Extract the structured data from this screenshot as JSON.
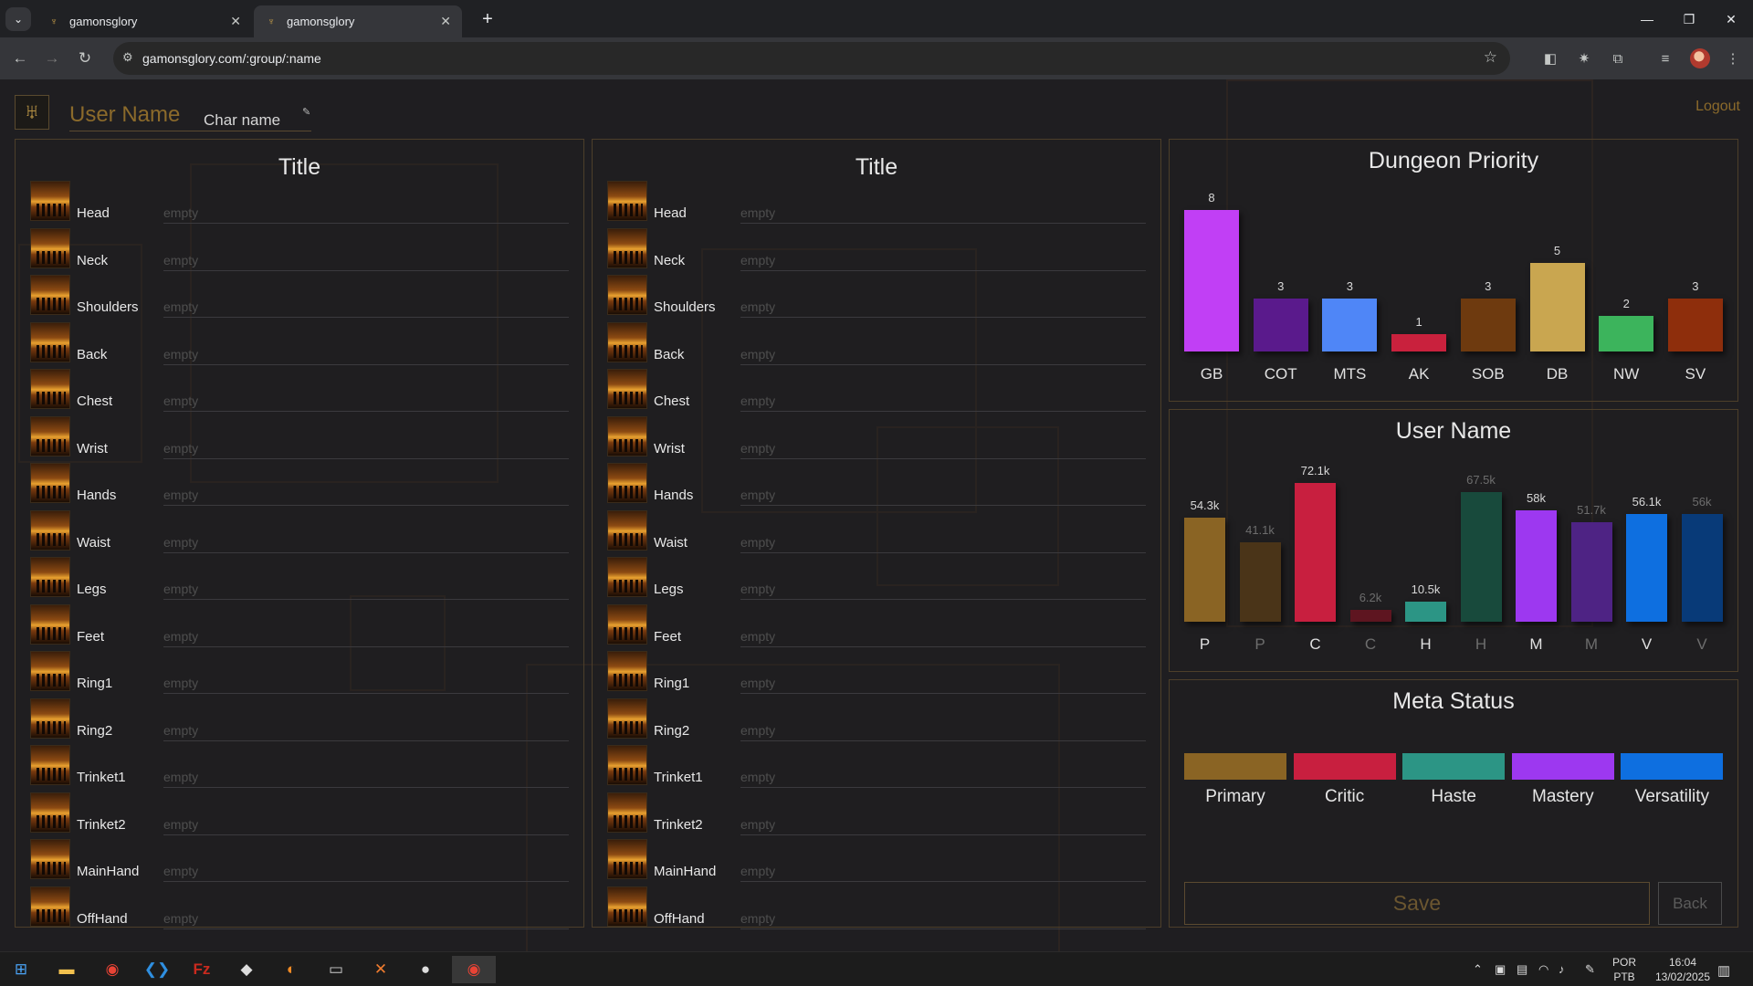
{
  "browser": {
    "tabs": [
      {
        "title": "gamonsglory",
        "active": false
      },
      {
        "title": "gamonsglory",
        "active": true
      }
    ],
    "url": "gamonsglory.com/:group/:name"
  },
  "header": {
    "user_name": "User Name",
    "char_name": "Char name",
    "logout_label": "Logout"
  },
  "gear_panels": [
    {
      "title": "Title"
    },
    {
      "title": "Title"
    }
  ],
  "slots": [
    {
      "label": "Head",
      "value": "empty"
    },
    {
      "label": "Neck",
      "value": "empty"
    },
    {
      "label": "Shoulders",
      "value": "empty"
    },
    {
      "label": "Back",
      "value": "empty"
    },
    {
      "label": "Chest",
      "value": "empty"
    },
    {
      "label": "Wrist",
      "value": "empty"
    },
    {
      "label": "Hands",
      "value": "empty"
    },
    {
      "label": "Waist",
      "value": "empty"
    },
    {
      "label": "Legs",
      "value": "empty"
    },
    {
      "label": "Feet",
      "value": "empty"
    },
    {
      "label": "Ring1",
      "value": "empty"
    },
    {
      "label": "Ring2",
      "value": "empty"
    },
    {
      "label": "Trinket1",
      "value": "empty"
    },
    {
      "label": "Trinket2",
      "value": "empty"
    },
    {
      "label": "MainHand",
      "value": "empty"
    },
    {
      "label": "OffHand",
      "value": "empty"
    }
  ],
  "chart_data": [
    {
      "type": "bar",
      "title": "Dungeon Priority",
      "categories": [
        "GB",
        "COT",
        "MTS",
        "AK",
        "SOB",
        "DB",
        "NW",
        "SV"
      ],
      "values": [
        8,
        3,
        3,
        1,
        3,
        5,
        2,
        3
      ],
      "value_labels": [
        "8",
        "3",
        "3",
        "1",
        "3",
        "5",
        "2",
        "3"
      ],
      "colors": [
        "#c13ff5",
        "#5a1a8c",
        "#4f86f7",
        "#c9213d",
        "#6e3a0f",
        "#c9a650",
        "#3cb45c",
        "#8e2e0c"
      ],
      "ylim": [
        0,
        8
      ]
    },
    {
      "type": "bar",
      "title": "User Name",
      "categories": [
        "P",
        "P",
        "C",
        "C",
        "H",
        "H",
        "M",
        "M",
        "V",
        "V"
      ],
      "values": [
        54.3,
        41.1,
        72.1,
        6.2,
        10.5,
        67.5,
        58,
        51.7,
        56.1,
        56
      ],
      "value_labels": [
        "54.3k",
        "41.1k",
        "72.1k",
        "6.2k",
        "10.5k",
        "67.5k",
        "58k",
        "51.7k",
        "56.1k",
        "56k"
      ],
      "dimmed": [
        false,
        true,
        false,
        true,
        false,
        true,
        false,
        true,
        false,
        true
      ],
      "colors": [
        "#8a6424",
        "#4a3418",
        "#c81f3f",
        "#5e1520",
        "#2c9585",
        "#184a3c",
        "#9d38f0",
        "#4e2384",
        "#0e6fe0",
        "#083a78"
      ],
      "ylim": [
        0,
        72.1
      ]
    }
  ],
  "meta_status": {
    "title": "Meta Status",
    "items": [
      {
        "label": "Primary",
        "color": "#8a6424"
      },
      {
        "label": "Critic",
        "color": "#c81f3f"
      },
      {
        "label": "Haste",
        "color": "#2c9585"
      },
      {
        "label": "Mastery",
        "color": "#9d38f0"
      },
      {
        "label": "Versatility",
        "color": "#0e6fe0"
      }
    ]
  },
  "actions": {
    "save_label": "Save",
    "back_label": "Back"
  },
  "taskbar": {
    "apps": [
      "windows-start",
      "file-explorer",
      "chrome",
      "vscode",
      "filezilla",
      "inkscape",
      "blender",
      "terminal",
      "xampp",
      "github-desktop",
      "chrome-active"
    ],
    "lang": "POR",
    "layout": "PTB",
    "time": "16:04",
    "date": "13/02/2025"
  }
}
